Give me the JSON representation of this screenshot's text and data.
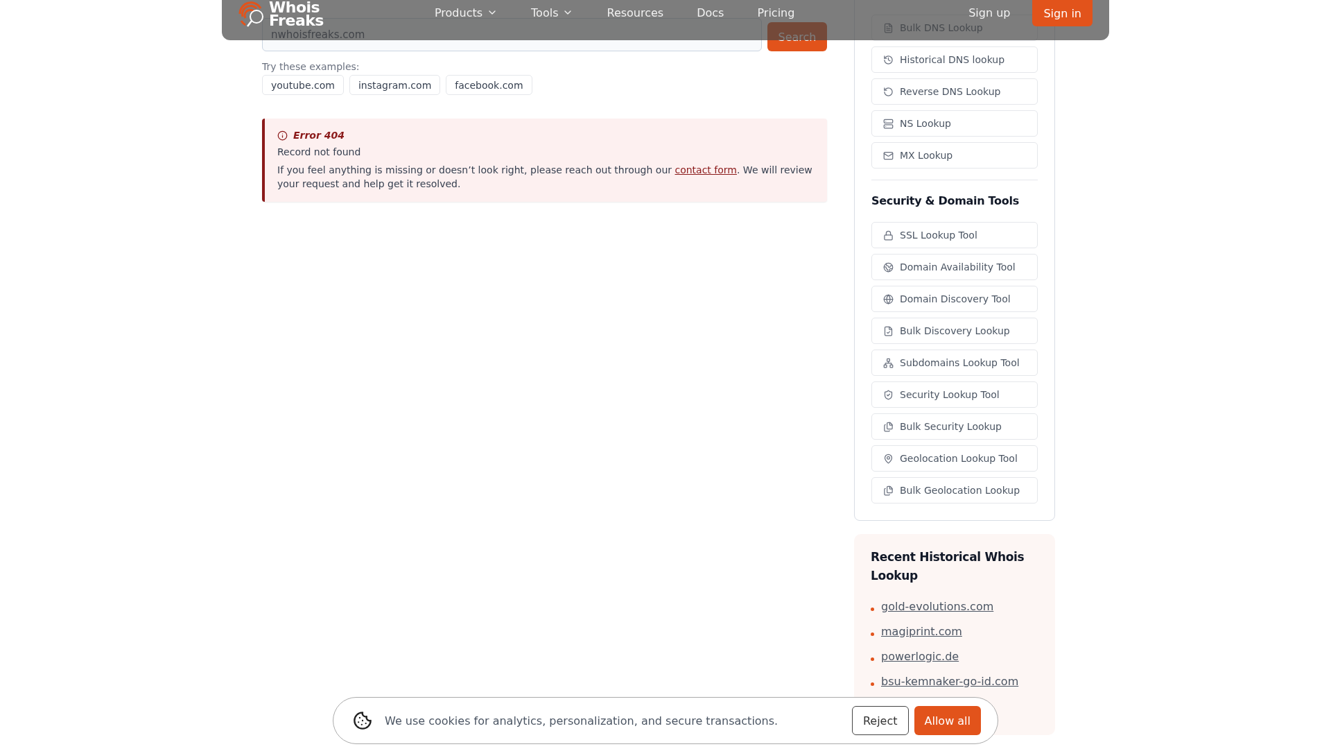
{
  "header": {
    "logo": {
      "line_1": "Whois",
      "line_2": "Freaks"
    },
    "nav": [
      {
        "label": "Products",
        "has_menu": true
      },
      {
        "label": "Tools",
        "has_menu": true
      },
      {
        "label": "Resources",
        "has_menu": false
      },
      {
        "label": "Docs",
        "has_menu": false
      },
      {
        "label": "Pricing",
        "has_menu": false
      }
    ],
    "sign_up": "Sign up",
    "sign_in": "Sign in"
  },
  "main": {
    "search": {
      "value": "nwhoisfreaks.com",
      "button": "Search"
    },
    "examples_label": "Try these examples:",
    "examples": [
      "youtube.com",
      "instagram.com",
      "facebook.com"
    ],
    "alert": {
      "title": "Error 404",
      "message": "Record not found",
      "body_before": "If you feel anything is missing or doesn’t look right, please reach out through our ",
      "link": "contact form",
      "body_after": ". We will review your request and help get it resolved."
    }
  },
  "sidebar": {
    "dns_tools": [
      "Bulk DNS Lookup",
      "Historical DNS lookup",
      "Reverse DNS Lookup",
      "NS Lookup",
      "MX Lookup"
    ],
    "security_heading": "Security & Domain Tools",
    "security_tools": [
      "SSL Lookup Tool",
      "Domain Availability Tool",
      "Domain Discovery Tool",
      "Bulk Discovery Lookup",
      "Subdomains Lookup Tool",
      "Security Lookup Tool",
      "Bulk Security Lookup",
      "Geolocation Lookup Tool",
      "Bulk Geolocation Lookup"
    ],
    "recent_heading": "Recent Historical Whois Lookup",
    "recent": [
      "gold-evolutions.com",
      "magiprint.com",
      "powerlogic.de",
      "bsu-kemnaker-go-id.com"
    ]
  },
  "cookie_banner": {
    "message": "We use cookies for analytics, personalization, and secure transactions.",
    "reject": "Reject",
    "accept": "Allow all"
  }
}
